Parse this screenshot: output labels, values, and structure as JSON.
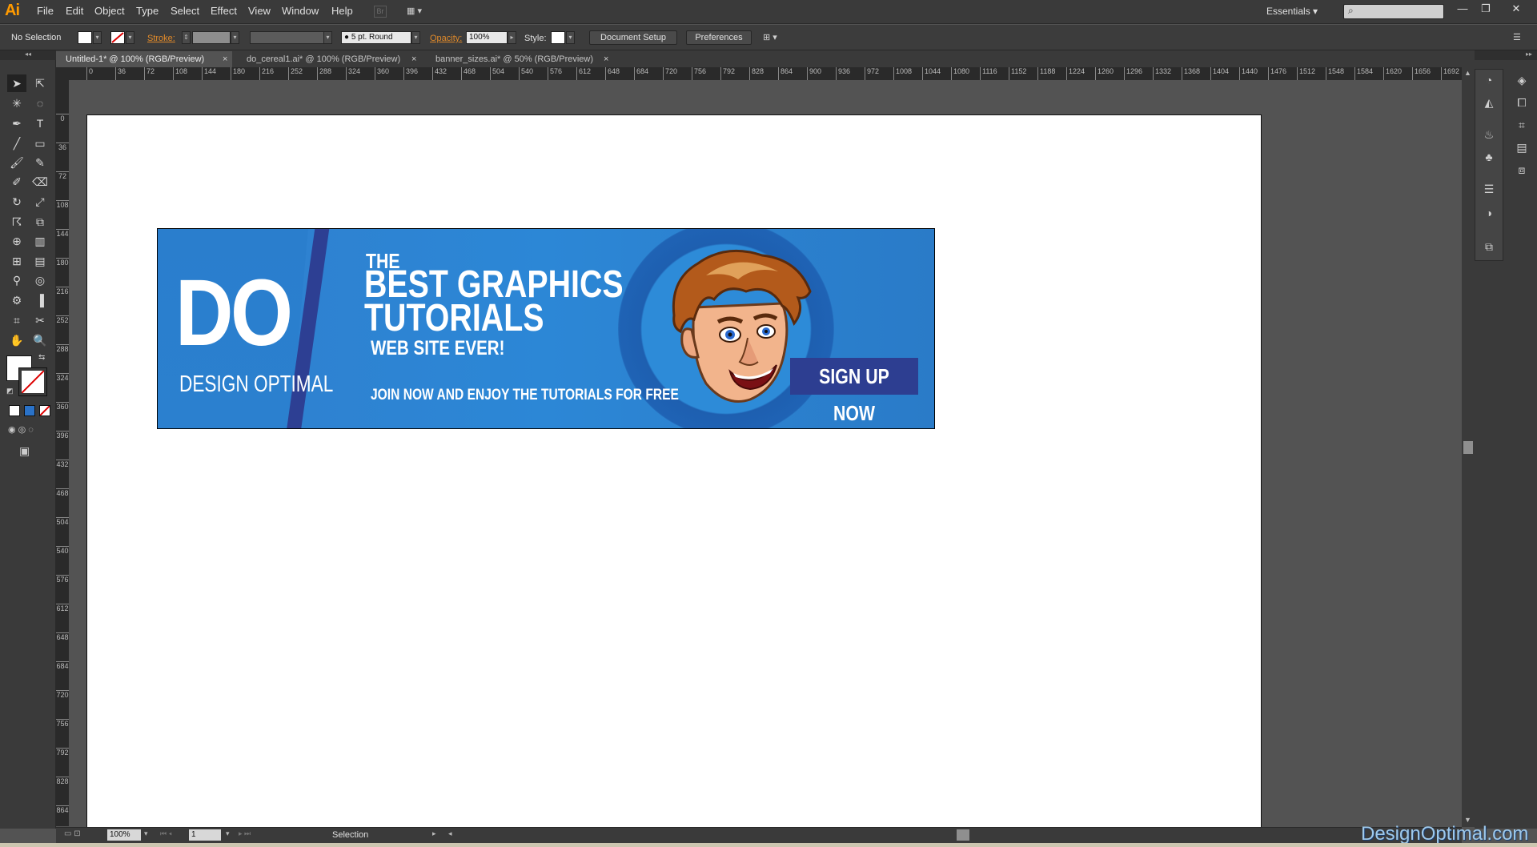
{
  "app": {
    "logo": "Ai"
  },
  "menu": [
    "File",
    "Edit",
    "Object",
    "Type",
    "Select",
    "Effect",
    "View",
    "Window",
    "Help"
  ],
  "menubar_extra": {
    "br": "Br",
    "arrange": "▦ ▾",
    "workspace": "Essentials ▾"
  },
  "window_controls": [
    "—",
    "❐",
    "✕"
  ],
  "control": {
    "selection": "No Selection",
    "stroke_label": "Stroke:",
    "brush": "● 5 pt. Round",
    "opacity_label": "Opacity:",
    "opacity_value": "100%",
    "style_label": "Style:",
    "document_setup": "Document Setup",
    "preferences": "Preferences"
  },
  "tabs": [
    {
      "label": "Untitled-1* @ 100% (RGB/Preview)",
      "active": true
    },
    {
      "label": "do_cereal1.ai* @ 100% (RGB/Preview)",
      "active": false
    },
    {
      "label": "banner_sizes.ai* @ 50% (RGB/Preview)",
      "active": false
    }
  ],
  "ruler_h": [
    "0",
    "36",
    "72",
    "108",
    "144",
    "180",
    "216",
    "252",
    "288",
    "324",
    "360",
    "396",
    "432",
    "468",
    "504",
    "540",
    "576",
    "612",
    "648",
    "684",
    "720",
    "756",
    "792",
    "828",
    "864",
    "900",
    "936",
    "972",
    "1008",
    "1044",
    "1080",
    "1116",
    "1152",
    "1188",
    "1224",
    "1260",
    "1296",
    "1332",
    "1368",
    "1404",
    "1440",
    "1476",
    "1512",
    "1548",
    "1584",
    "1620",
    "1656",
    "1692"
  ],
  "ruler_v": [
    "0",
    "36",
    "72",
    "108",
    "144",
    "180",
    "216",
    "252",
    "288",
    "324",
    "360",
    "396",
    "432",
    "468",
    "504",
    "540",
    "576",
    "612",
    "648",
    "684",
    "720",
    "756",
    "792",
    "828",
    "864"
  ],
  "banner": {
    "logo_big": "DO",
    "logo_sub": "DESIGN OPTIMAL",
    "line_the": "THE",
    "line_best": "BEST GRAPHICS",
    "line_tutorials": "TUTORIALS",
    "line_web": "WEB SITE EVER!",
    "line_join": "JOIN NOW AND ENJOY THE TUTORIALS FOR FREE",
    "cta": "SIGN UP NOW"
  },
  "status": {
    "zoom": "100%",
    "page": "1",
    "tool": "Selection"
  },
  "watermark": "DesignOptimal.com",
  "colors": {
    "accent": "#ff9a00",
    "banner_blue": "#2c87d6",
    "cta_navy": "#2d3e91"
  }
}
